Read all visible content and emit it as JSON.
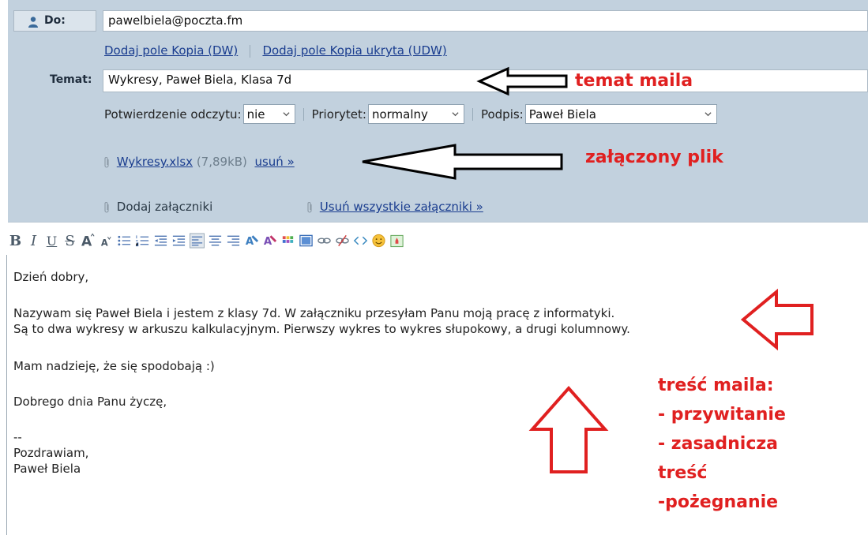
{
  "to": {
    "label": "Do:",
    "value": "pawelbiela@poczta.fm"
  },
  "copy_links": {
    "cc": "Dodaj pole Kopia (DW)",
    "bcc": "Dodaj pole Kopia ukryta (UDW)"
  },
  "subject": {
    "label": "Temat:",
    "value": "Wykresy, Paweł Biela, Klasa 7d"
  },
  "options": {
    "read_receipt_label": "Potwierdzenie odczytu:",
    "read_receipt_value": "nie",
    "priority_label": "Priorytet:",
    "priority_value": "normalny",
    "signature_label": "Podpis:",
    "signature_value": "Paweł Biela"
  },
  "attachment": {
    "filename": "Wykresy.xlsx",
    "size": "(7,89kB)",
    "remove": "usuń »"
  },
  "attachment_actions": {
    "add": "Dodaj załączniki",
    "remove_all": "Usuń wszystkie załączniki »"
  },
  "toolbar": {
    "bold": "B",
    "italic": "I",
    "underline": "U",
    "strike": "S"
  },
  "body": {
    "greeting": "Dzień dobry,",
    "line1": "Nazywam się Paweł Biela i jestem z klasy 7d. W załączniku przesyłam Panu moją pracę z informatyki.",
    "line2": "Są to dwa wykresy w arkuszu kalkulacyjnym. Pierwszy wykres to wykres słupokowy, a drugi kolumnowy.",
    "line3": "Mam nadzieję, że się spodobają :)",
    "line4": "Dobrego dnia Panu życzę,",
    "sig_sep": "--",
    "sig1": "Pozdrawiam,",
    "sig2": "Paweł Biela"
  },
  "annotations": {
    "subject": "temat maila",
    "attachment": "załączony plik",
    "content": [
      "treść maila:",
      "- przywitanie",
      "- zasadnicza",
      "treść",
      "-pożegnanie"
    ]
  },
  "colors": {
    "header_bg": "#c2d1de",
    "link": "#1a3d8f",
    "annotation": "#e02020"
  }
}
